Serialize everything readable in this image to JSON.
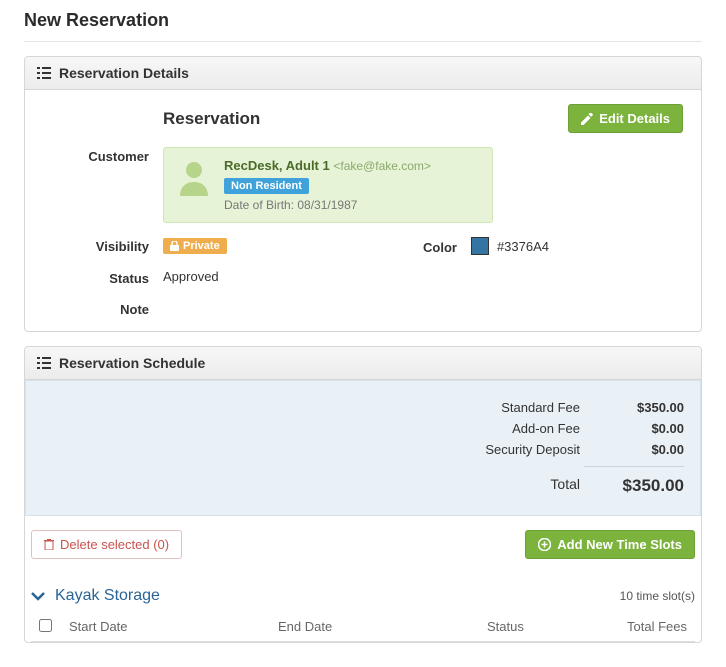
{
  "page_title": "New Reservation",
  "panels": {
    "details_title": "Reservation Details",
    "schedule_title": "Reservation Schedule"
  },
  "reservation": {
    "section_title": "Reservation",
    "edit_button": "Edit Details",
    "labels": {
      "customer": "Customer",
      "visibility": "Visibility",
      "color": "Color",
      "status": "Status",
      "note": "Note"
    },
    "customer": {
      "name": "RecDesk, Adult 1",
      "email": "<fake@fake.com>",
      "residency_badge": "Non Resident",
      "dob_label": "Date of Birth: ",
      "dob": "08/31/1987"
    },
    "visibility_badge": "Private",
    "color_hex": "#3376A4",
    "status": "Approved",
    "note": ""
  },
  "fees": {
    "standard_label": "Standard Fee",
    "standard_value": "$350.00",
    "addon_label": "Add-on Fee",
    "addon_value": "$0.00",
    "deposit_label": "Security Deposit",
    "deposit_value": "$0.00",
    "total_label": "Total",
    "total_value": "$350.00"
  },
  "actions": {
    "delete_selected": "Delete selected (0)",
    "add_time_slots": "Add New Time Slots"
  },
  "group": {
    "name": "Kayak Storage",
    "slots_text": "10 time slot(s)"
  },
  "table": {
    "start": "Start Date",
    "end": "End Date",
    "status": "Status",
    "fees": "Total Fees"
  }
}
